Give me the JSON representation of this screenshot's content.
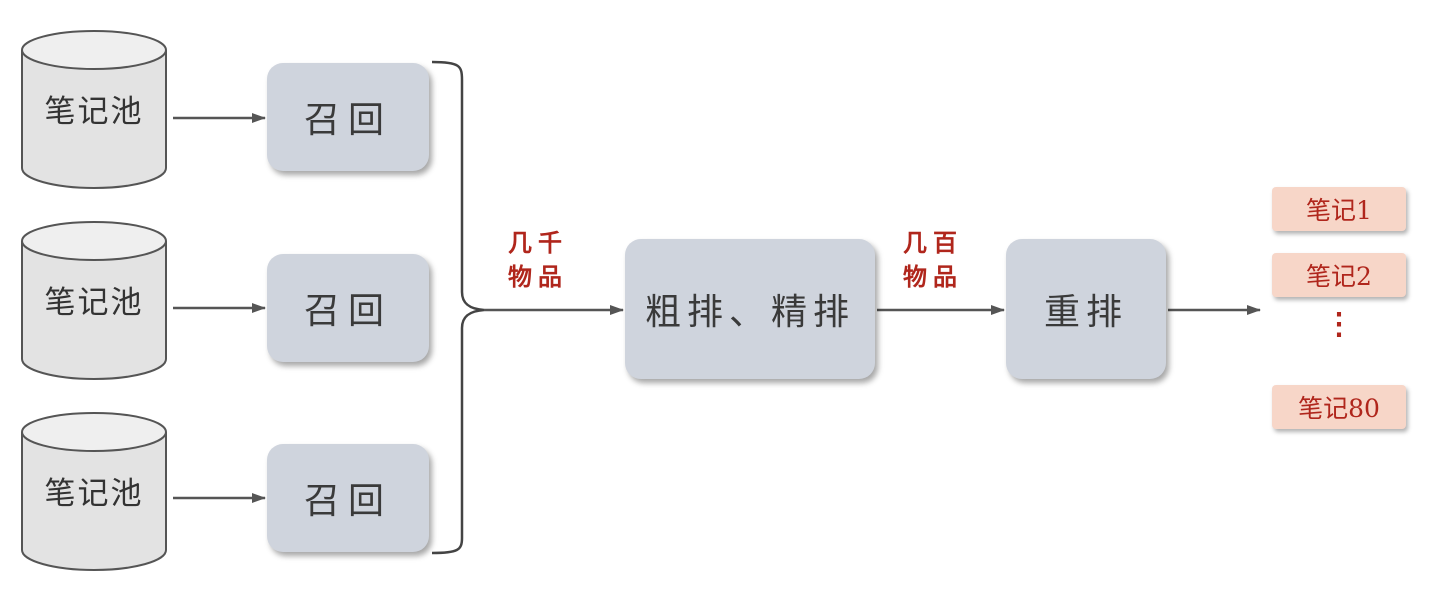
{
  "sources": [
    {
      "pool": "笔记池",
      "step": "召回"
    },
    {
      "pool": "笔记池",
      "step": "召回"
    },
    {
      "pool": "笔记池",
      "step": "召回"
    }
  ],
  "flow_labels": {
    "after_recall": [
      "几千",
      "物品"
    ],
    "after_ranking": [
      "几百",
      "物品"
    ]
  },
  "ranking": "粗排、精排",
  "reranking": "重排",
  "outputs": {
    "items": [
      "笔记1",
      "笔记2"
    ],
    "ellipsis": "⋮",
    "last": "笔记80"
  },
  "colors": {
    "box_fill": "#cfd4dd",
    "cylinder_fill": "#e3e3e3",
    "accent_red": "#b0261c",
    "note_fill": "#f7d6c8",
    "line": "#555555"
  }
}
